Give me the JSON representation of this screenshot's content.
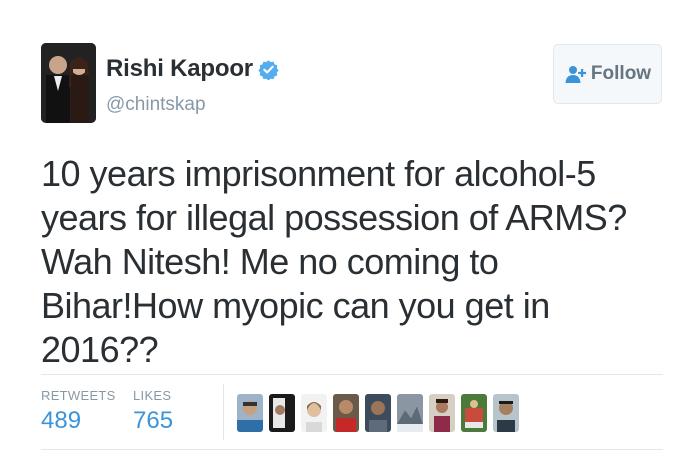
{
  "tweet": {
    "display_name": "Rishi Kapoor",
    "handle": "@chintskap",
    "text": "10 years imprisonment for alcohol-5 years for illegal possession of ARMS? Wah Nitesh! Me no coming to Bihar!How myopic can you get in 2016??",
    "follow_label": "Follow",
    "verified_icon": "verified-badge-icon",
    "follow_icon": "add-user-icon"
  },
  "stats": {
    "retweets_label": "RETWEETS",
    "retweets_value": "489",
    "likes_label": "LIKES",
    "likes_value": "765"
  },
  "likers": {
    "count_shown": 9
  },
  "colors": {
    "accent": "#3b94d9",
    "verified": "#55acee",
    "muted": "#8899a6",
    "text": "#292f33",
    "border": "#e1e8ed"
  }
}
